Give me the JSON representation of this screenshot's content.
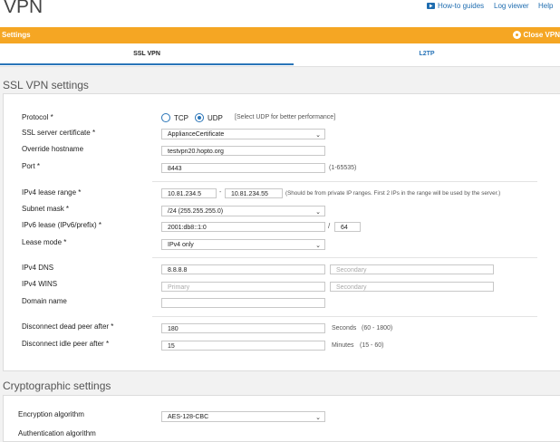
{
  "header": {
    "title": "VPN",
    "links": {
      "guides": "How-to guides",
      "log_viewer": "Log viewer",
      "help": "Help"
    }
  },
  "banner": {
    "label": "Settings",
    "close": "Close VPN"
  },
  "tabs": {
    "ssl": "SSL VPN",
    "l2tp": "L2TP"
  },
  "ssl": {
    "section_title": "SSL VPN settings",
    "protocol": {
      "label": "Protocol *",
      "tcp": "TCP",
      "udp": "UDP",
      "selected": "UDP",
      "hint": "[Select UDP for better performance]"
    },
    "certificate": {
      "label": "SSL server certificate *",
      "value": "ApplianceCertificate"
    },
    "hostname": {
      "label": "Override hostname",
      "value": "testvpn20.hopto.org"
    },
    "port": {
      "label": "Port *",
      "value": "8443",
      "hint": "(1-65535)"
    },
    "ipv4_range": {
      "label": "IPv4 lease range *",
      "from": "10.81.234.5",
      "dash": "-",
      "to": "10.81.234.55",
      "hint": "(Should be from private IP ranges. First 2 IPs in the range will be used by the server.)"
    },
    "subnet": {
      "label": "Subnet mask *",
      "value": "/24 (255.255.255.0)"
    },
    "ipv6": {
      "label": "IPv6 lease (IPv6/prefix) *",
      "value": "2001:db8::1:0",
      "slash": "/",
      "prefix": "64"
    },
    "lease_mode": {
      "label": "Lease mode *",
      "value": "IPv4 only"
    },
    "dns": {
      "label": "IPv4 DNS",
      "primary": "8.8.8.8",
      "secondary_placeholder": "Secondary"
    },
    "wins": {
      "label": "IPv4 WINS",
      "primary_placeholder": "Primary",
      "secondary_placeholder": "Secondary"
    },
    "domain": {
      "label": "Domain name",
      "value": ""
    },
    "dead_peer": {
      "label": "Disconnect dead peer after *",
      "value": "180",
      "unit": "Seconds",
      "range": "(60 - 1800)"
    },
    "idle_peer": {
      "label": "Disconnect idle peer after *",
      "value": "15",
      "unit": "Minutes",
      "range": "(15 - 60)"
    }
  },
  "crypto": {
    "section_title": "Cryptographic settings",
    "encryption": {
      "label": "Encryption algorithm",
      "value": "AES-128-CBC"
    },
    "authentication": {
      "label": "Authentication algorithm"
    }
  },
  "colors": {
    "accent": "#f5a623",
    "link": "#1f6db0",
    "tab_active": "#2a75b8"
  }
}
